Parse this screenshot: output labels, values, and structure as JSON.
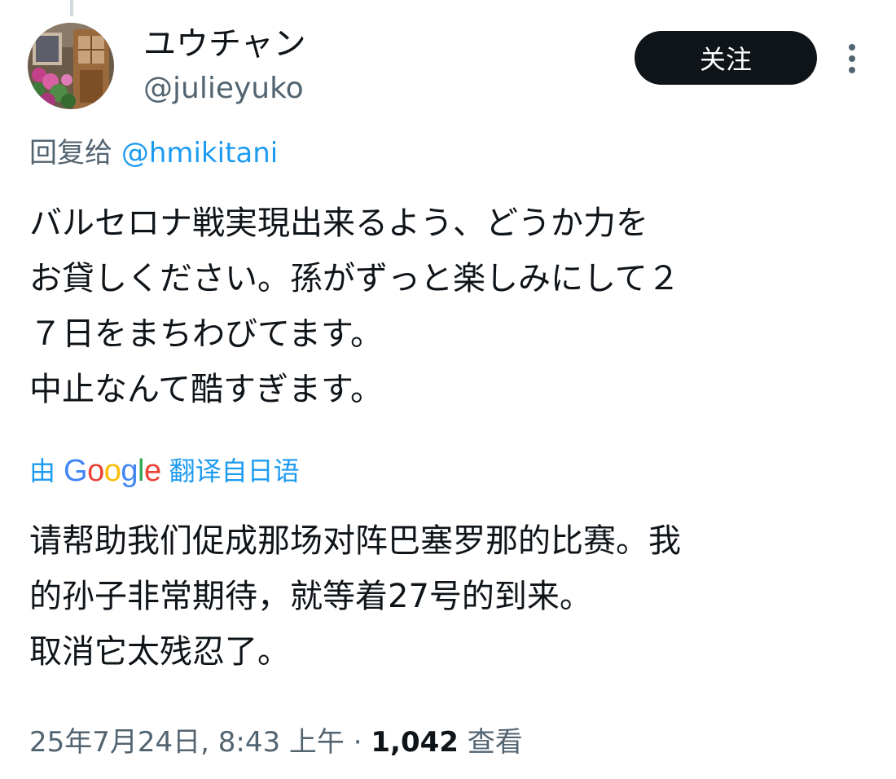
{
  "author": {
    "display_name": "ユウチャン",
    "handle": "@julieyuko"
  },
  "follow_label": "关注",
  "reply": {
    "prefix": "回复给",
    "target": "@hmikitani"
  },
  "original_text_lines": [
    "バルセロナ戦実現出来るよう、どうか力を",
    "お貸しください。孫がずっと楽しみにして２",
    "７日をまちわびてます。",
    "中止なんて酷すぎます。"
  ],
  "translation": {
    "prefix": "由",
    "provider": "Google",
    "suffix": "翻译自日语"
  },
  "translated_text_lines": [
    "请帮助我们促成那场对阵巴塞罗那的比赛。我",
    "的孙子非常期待，就等着27号的到来。",
    "取消它太残忍了。"
  ],
  "meta": {
    "timestamp": "25年7月24日, 8:43 上午",
    "separator": "·",
    "views_count": "1,042",
    "views_label": "查看"
  },
  "icons": {
    "avatar": "avatar-photo",
    "more": "more-vertical-icon"
  },
  "colors": {
    "link_blue": "#1d9bf0",
    "secondary_text": "#536471",
    "primary_text": "#0f1419",
    "follow_bg": "#0f1419",
    "google_blue": "#4285F4",
    "google_red": "#EA4335",
    "google_yellow": "#FBBC05",
    "google_green": "#34A853"
  }
}
